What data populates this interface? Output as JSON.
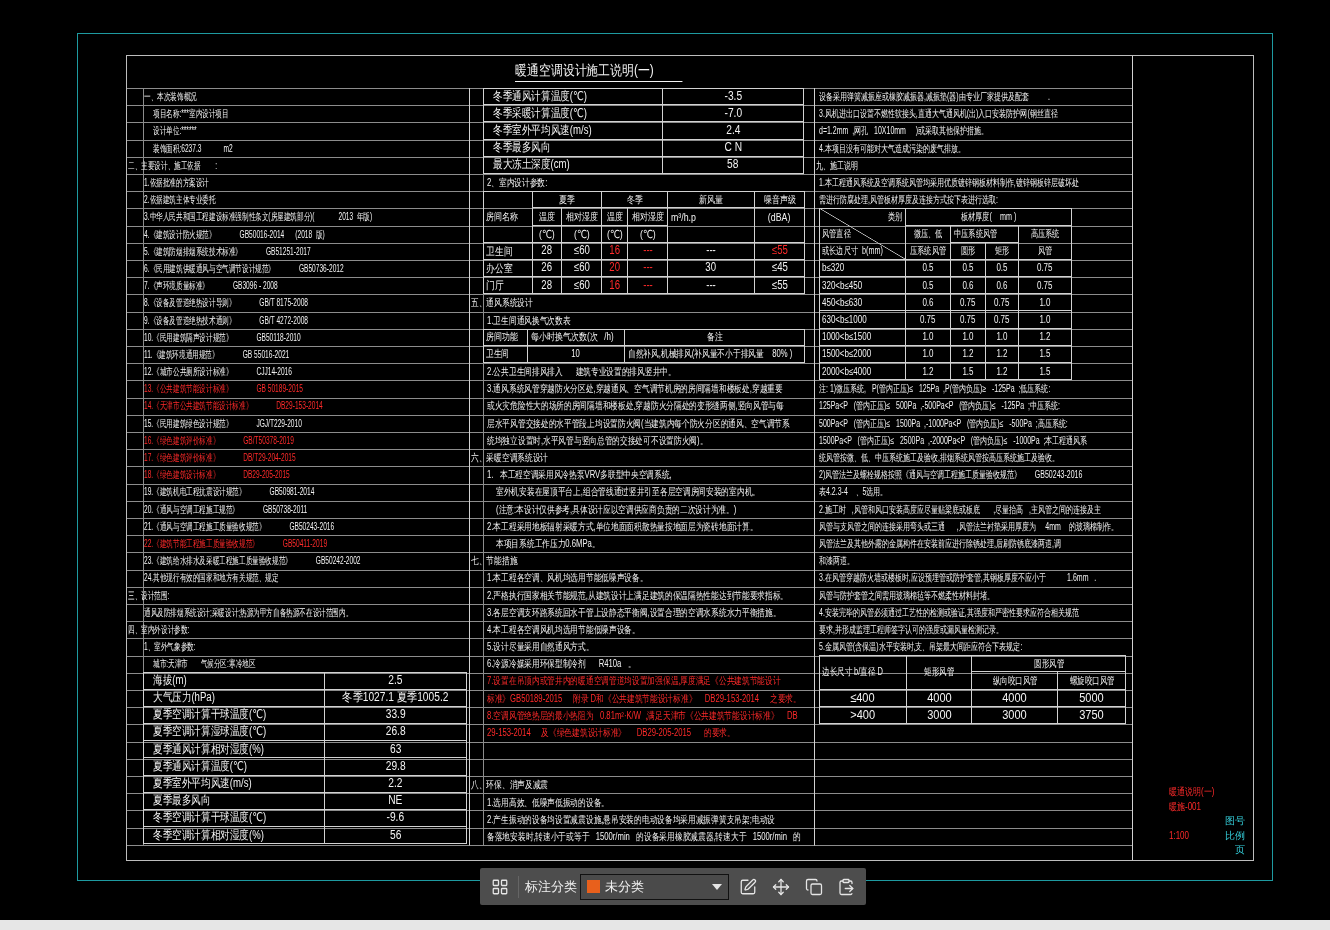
{
  "drawing": {
    "title": "暖通空调设计施工说明(一)",
    "columns": [
      {
        "blocks": [
          {
            "kind": "item",
            "text": "一、本次装饰概况",
            "highlighted": false
          },
          {
            "kind": "detail",
            "text": "项目名称:***室内设计项目",
            "highlighted": false
          },
          {
            "kind": "detail",
            "text": "设计单位:******",
            "highlighted": false
          },
          {
            "kind": "detail",
            "text": "装饰面积:6237.3            m2",
            "highlighted": false
          },
          {
            "kind": "section",
            "text": "二、主要设计、施工依据        :",
            "highlighted": false
          },
          {
            "kind": "item",
            "text": "1.依据批准的方案设计",
            "highlighted": false
          },
          {
            "kind": "item",
            "text": "2.依据建筑主体专业委托",
            "highlighted": false
          },
          {
            "kind": "item",
            "text": "3.中华人民共和国工程建设标准强制性条文(房屋建筑部分)(",
            "reference": "2013  年版)",
            "highlighted": false
          },
          {
            "kind": "item",
            "text": "4.《建筑设计防火规范》",
            "reference": "GB50016-2014      (2018  版)",
            "highlighted": false
          },
          {
            "kind": "item",
            "text": "5.《建筑防烟排烟系统技术标准》",
            "reference": "GB51251-2017",
            "highlighted": false
          },
          {
            "kind": "item",
            "text": "6.《民用建筑供暖通风与空气调节设计规范》",
            "reference": "GB50736-2012",
            "highlighted": false
          },
          {
            "kind": "item",
            "text": "7.《声环境质量标准》",
            "reference": "GB3096 - 2008",
            "highlighted": false
          },
          {
            "kind": "item",
            "text": "8.《设备及管道绝热设计导则》",
            "reference": "GB/T 8175-2008",
            "highlighted": false
          },
          {
            "kind": "item",
            "text": "9.《设备及管道绝热技术通则》",
            "reference": "GB/T 4272-2008",
            "highlighted": false
          },
          {
            "kind": "item",
            "text": "10.《民用建筑隔声设计规范》",
            "reference": "GB50118-2010",
            "highlighted": false
          },
          {
            "kind": "item",
            "text": "11.《建筑环境通用规范》",
            "reference": "GB 55016-2021",
            "highlighted": false
          },
          {
            "kind": "item",
            "text": "12.《城市公共厕所设计标准》",
            "reference": "CJJ14-2016",
            "highlighted": false
          },
          {
            "kind": "item",
            "text": "13.《公共建筑节能设计标准》",
            "reference": "GB 50189-2015",
            "highlighted": true
          },
          {
            "kind": "item",
            "text": "14.《天津市公共建筑节能设计标准》",
            "reference": "DB29-153-2014",
            "highlighted": true
          },
          {
            "kind": "item",
            "text": "15.《民用建筑绿色设计规范》",
            "reference": "JGJ/T229-2010",
            "highlighted": false
          },
          {
            "kind": "item",
            "text": "16.《绿色建筑评价标准》",
            "reference": "GB/T50378-2019",
            "highlighted": true
          },
          {
            "kind": "item",
            "text": "17.《绿色建筑评价标准》",
            "reference": "DB/T29-204-2015",
            "highlighted": true
          },
          {
            "kind": "item",
            "text": "18.《绿色建筑设计标准》",
            "reference": "DB29-205-2015",
            "highlighted": true
          },
          {
            "kind": "item",
            "text": "19.《建筑机电工程抗震设计规范》",
            "reference": "GB50981-2014",
            "highlighted": false
          },
          {
            "kind": "item",
            "text": "20.《通风与空调工程施工规范》",
            "reference": "GB50738-2011",
            "highlighted": false
          },
          {
            "kind": "item",
            "text": "21.《通风与空调工程施工质量验收规范》",
            "reference": "GB50243-2016",
            "highlighted": false
          },
          {
            "kind": "item",
            "text": "22.《建筑节能工程施工质量验收规范》",
            "reference": "GB50411-2019",
            "highlighted": true
          },
          {
            "kind": "item",
            "text": "23.《建筑给水排水及采暖工程施工质量验收规范》",
            "reference": "GB50242-2002",
            "highlighted": false
          },
          {
            "kind": "item",
            "text": "24.其他现行有效的国家和地方有关规范、规定",
            "highlighted": false
          },
          {
            "kind": "section",
            "text": "三、设计范围:",
            "highlighted": false
          },
          {
            "kind": "item",
            "text": "通风及防排烟系统设计;采暖设计;热源为甲方自备热源不在设计范围内。",
            "highlighted": false
          },
          {
            "kind": "section",
            "text": "四、室内外设计参数:",
            "highlighted": false
          },
          {
            "kind": "item",
            "text": "1、室外气象参数:",
            "highlighted": false
          },
          {
            "kind": "detail",
            "text": "城市:天津市       气候分区:寒冷地区",
            "highlighted": false
          },
          {
            "kind": "pair_table",
            "rows": [
              {
                "label": "海拔(m)",
                "value": "2.5"
              },
              {
                "label": "大气压力(hPa)",
                "value": "冬季1027.1 夏季1005.2"
              },
              {
                "label": "夏季空调计算干球温度(℃)",
                "value": "33.9"
              },
              {
                "label": "夏季空调计算湿球温度(℃)",
                "value": "26.8"
              },
              {
                "label": "夏季通风计算相对湿度(%)",
                "value": "63"
              },
              {
                "label": "夏季通风计算温度(℃)",
                "value": "29.8"
              },
              {
                "label": "夏季室外平均风速(m/s)",
                "value": "2.2"
              },
              {
                "label": "夏季最多风向",
                "value": "NE"
              },
              {
                "label": "冬季空调计算干球温度(℃)",
                "value": "-9.6"
              },
              {
                "label": "冬季空调计算相对湿度(%)",
                "value": "56"
              }
            ]
          }
        ]
      },
      {
        "blocks": [
          {
            "kind": "pair_table",
            "rows": [
              {
                "label": "冬季通风计算温度(℃)",
                "value": "-3.5"
              },
              {
                "label": "冬季采暖计算温度(℃)",
                "value": "-7.0"
              },
              {
                "label": "冬季室外平均风速(m/s)",
                "value": "2.4"
              },
              {
                "label": "冬季最多风向",
                "value": "C N"
              },
              {
                "label": "最大冻土深度(cm)",
                "value": "58"
              }
            ]
          },
          {
            "kind": "item",
            "text": "2、室内设计参数:",
            "highlighted": false
          },
          {
            "kind": "room_table",
            "headers": {
              "room": "房间名称",
              "summer": "夏季",
              "winter": "冬季",
              "fresh_air": "新风量",
              "noise": "噪音声级"
            },
            "subheaders": [
              "温度",
              "相对湿度",
              "温度",
              "相对湿度",
              "m³/h.p",
              "(dBA)"
            ],
            "units": [
              "(℃)",
              "(℃)",
              "(℃)",
              "(℃)"
            ],
            "rows": [
              {
                "cells": [
                  {
                    "text": "卫生间",
                    "highlighted": false
                  },
                  {
                    "text": "28",
                    "highlighted": false
                  },
                  {
                    "text": "≤60",
                    "highlighted": false
                  },
                  {
                    "text": "16",
                    "highlighted": true
                  },
                  {
                    "text": "---",
                    "highlighted": true
                  },
                  {
                    "text": "---",
                    "highlighted": false
                  },
                  {
                    "text": "≤55",
                    "highlighted": true
                  }
                ]
              },
              {
                "cells": [
                  {
                    "text": "办公室",
                    "highlighted": false
                  },
                  {
                    "text": "26",
                    "highlighted": false
                  },
                  {
                    "text": "≤60",
                    "highlighted": false
                  },
                  {
                    "text": "20",
                    "highlighted": true
                  },
                  {
                    "text": "---",
                    "highlighted": true
                  },
                  {
                    "text": "30",
                    "highlighted": false
                  },
                  {
                    "text": "≤45",
                    "highlighted": false
                  }
                ]
              },
              {
                "cells": [
                  {
                    "text": "门厅",
                    "highlighted": false
                  },
                  {
                    "text": "28",
                    "highlighted": false
                  },
                  {
                    "text": "≤60",
                    "highlighted": false
                  },
                  {
                    "text": "16",
                    "highlighted": true
                  },
                  {
                    "text": "---",
                    "highlighted": true
                  },
                  {
                    "text": "---",
                    "highlighted": false
                  },
                  {
                    "text": "≤55",
                    "highlighted": false
                  }
                ]
              }
            ]
          },
          {
            "kind": "section",
            "text": "五、通风系统设计",
            "highlighted": false
          },
          {
            "kind": "item",
            "text": "1.卫生间通风换气次数表",
            "highlighted": false
          },
          {
            "kind": "vent_table",
            "columns": [
              "房间功能",
              "每小时换气次数(次   /h)",
              "备注"
            ],
            "rows": [
              [
                "卫生间",
                "10",
                "自然补风,机械排风(补风量不小于排风量    80% )"
              ]
            ]
          },
          {
            "kind": "item",
            "text": "2.公共卫生间排风排入      建筑专业设置的排风竖井中。",
            "highlighted": false
          },
          {
            "kind": "item",
            "text": "3.通风系统风管穿越防火分区处,穿越通风、空气调节机房的房间隔墙和楼板处,穿越重要",
            "highlighted": false
          },
          {
            "kind": "item",
            "text": "或火灾危险性大的场所的房间隔墙和楼板处,穿越防火分隔处的变形缝两侧,竖向风管与每",
            "highlighted": false
          },
          {
            "kind": "item",
            "text": "层水平风管交接处的水平管段上均设置防火阀(当建筑内每个防火分区的通风、空气调节系",
            "highlighted": false
          },
          {
            "kind": "item",
            "text": "统均独立设置时,水平风管与竖向总管的交接处可不设置防火阀)。",
            "highlighted": false
          },
          {
            "kind": "section",
            "text": "六、采暖空调系统设计",
            "highlighted": false
          },
          {
            "kind": "item",
            "text": "1.   本工程空调采用风冷热泵VRV多联型中央空调系统,",
            "highlighted": false
          },
          {
            "kind": "detail",
            "text": "室外机安装在屋顶平台上,组合管线通过竖井引至各层空调房间安装的室内机。",
            "highlighted": false
          },
          {
            "kind": "detail",
            "text": "(注意:本设计仅供参考,具体设计应以空调供应商负责的二次设计为准。)",
            "highlighted": false
          },
          {
            "kind": "item",
            "text": "2.本工程采用地板辐射采暖方式,单位地面面积散热量按地面层为瓷砖地面计算。",
            "highlighted": false
          },
          {
            "kind": "detail",
            "text": "本项目系统工作压力0.6MPa。",
            "highlighted": false
          },
          {
            "kind": "section",
            "text": "七、节能措施",
            "highlighted": false
          },
          {
            "kind": "item",
            "text": "1.本工程各空调、风机均选用节能低噪声设备。",
            "highlighted": false
          },
          {
            "kind": "item",
            "text": "2.严格执行国家相关节能规范,从建筑设计上满足建筑的保温隔热性能达到节能要求指标。",
            "highlighted": false
          },
          {
            "kind": "item",
            "text": "3.各层空调支环路系统回水干管上设静态平衡阀,设置合理的空调水系统水力平衡措施。",
            "highlighted": false
          },
          {
            "kind": "item",
            "text": "4.本工程各空调风机均选用节能低噪声设备。",
            "highlighted": false
          },
          {
            "kind": "item",
            "text": "5.设计尽量采用自然通风方式。",
            "highlighted": false
          },
          {
            "kind": "item",
            "text": "6.冷源冷媒采用环保型制冷剂      R410a   。",
            "highlighted": false
          },
          {
            "kind": "item",
            "text": "7.设置在吊顶内或管井内的暖通空调管道均设置加强保温,厚度满足《公共建筑节能设计",
            "highlighted": true
          },
          {
            "kind": "item",
            "text": "标准》GB50189-2015     附录 D和《公共建筑节能设计标准》    DB29-153-2014     之要求。",
            "highlighted": true
          },
          {
            "kind": "item",
            "text": "8.空调风管绝热层的最小热阻为   0.81m²·K/W  ,满足天津市《公共建筑节能设计标准》    DB",
            "highlighted": true
          },
          {
            "kind": "item",
            "text": "29-153-2014     及《绿色建筑设计标准》     DB29-205-2015      的要求。",
            "highlighted": true
          }
        ],
        "bottom_blocks": [
          {
            "kind": "section",
            "text": "八、环保、消声及减震",
            "highlighted": false
          },
          {
            "kind": "item",
            "text": "1.选用高效、低噪声低振动的设备。",
            "highlighted": false
          },
          {
            "kind": "item",
            "text": "2.产生振动的设备均设置减震设施,悬吊安装的电动设备均采用减振弹簧支吊架;电动设",
            "highlighted": false
          },
          {
            "kind": "item",
            "text": "备落地安装时,转速小于或等于   1500r/min   的设备采用橡胶减震器,转速大于   1500r/min   的",
            "highlighted": false
          }
        ]
      },
      {
        "blocks": [
          {
            "kind": "line",
            "text": "设备采用弹簧减振座或橡胶减振器,减振垫(器)由专业厂家提供及配套          .",
            "highlighted": false
          },
          {
            "kind": "line",
            "text": "3.风机进出口设置不燃性软接头,直通大气通风机(出)入口安装防护网(钢丝直径",
            "highlighted": false
          },
          {
            "kind": "line",
            "text": "d=1.2mm  ,网孔   10X10mm     )或采取其他保护措施。",
            "highlighted": false
          },
          {
            "kind": "line",
            "text": "4.本项目没有可能对大气造成污染的废气排放。",
            "highlighted": false
          },
          {
            "kind": "section",
            "text": "九、施工说明",
            "highlighted": false
          },
          {
            "kind": "line",
            "text": "1.本工程通风系统及空调系统风管均采用优质镀锌钢板材料制作,镀锌钢板锌层破坏处",
            "highlighted": false
          },
          {
            "kind": "line",
            "text": "需进行防腐处理,风管板材厚度及连接方式按下表进行选取:",
            "highlighted": false
          },
          {
            "kind": "thickness_table",
            "corner": [
              "类别",
              "风管直径",
              "或长边尺寸  b(mm)"
            ],
            "title": "板材厚度(    mm )",
            "low": [
              "微压、低",
              "压系统风管"
            ],
            "medium": "中压系统风管",
            "medium_sub": [
              "圆形",
              "矩形"
            ],
            "high": [
              "高压系统",
              "风管"
            ],
            "rows": [
              [
                "b≤320",
                "0.5",
                "0.5",
                "0.5",
                "0.75"
              ],
              [
                "320<b≤450",
                "0.5",
                "0.6",
                "0.6",
                "0.75"
              ],
              [
                "450<b≤630",
                "0.6",
                "0.75",
                "0.75",
                "1.0"
              ],
              [
                "630<b≤1000",
                "0.75",
                "0.75",
                "0.75",
                "1.0"
              ],
              [
                "1000<b≤1500",
                "1.0",
                "1.0",
                "1.0",
                "1.2"
              ],
              [
                "1500<b≤2000",
                "1.0",
                "1.2",
                "1.2",
                "1.5"
              ],
              [
                "2000<b≤4000",
                "1.2",
                "1.5",
                "1.2",
                "1.5"
              ]
            ]
          },
          {
            "kind": "line",
            "text": "注: 1)微压系统,   P(管内正压)≤   125Pa  ,P(管内负压)≥   -125Pa  ;低压系统:",
            "highlighted": false
          },
          {
            "kind": "line",
            "text": "125Pa<P   (管内正压)≤   500Pa  ,-500Pa<P   (管内负压)≤   -125Pa  ;中压系统:",
            "highlighted": false
          },
          {
            "kind": "line",
            "text": "500Pa<P   (管内正压)≤   1500Pa  ,-1000Pa<P   (管内负压)≤   -500Pa  ;高压系统:",
            "highlighted": false
          },
          {
            "kind": "line",
            "text": "1500Pa<P   (管内正压)≤   2500Pa  ,-2000Pa<P   (管内负压)≤   -1000Pa  ;本工程通风系",
            "highlighted": false
          },
          {
            "kind": "line",
            "text": "统风管按微、低、中压系统施工及验收,排烟系统风管按高压系统施工及验收。",
            "highlighted": false
          },
          {
            "kind": "line",
            "text": "2)风管法兰及螺栓规格按照《通风与空调工程施工质量验收规范》       GB50243-2016",
            "highlighted": false
          },
          {
            "kind": "line",
            "text": "表4.2.3-4    、5选用。",
            "highlighted": false
          },
          {
            "kind": "line",
            "text": "2.施工时   ,风管和风口安装高度应尽量贴梁底或板底       ,尽量抬高   ,主风管之间的连接及主",
            "highlighted": false
          },
          {
            "kind": "line",
            "text": "风管与支风管之间的连接采用弯头或三通      ,风管法兰衬垫采用厚度为     4mm    的玻璃棉制作。",
            "highlighted": false
          },
          {
            "kind": "line",
            "text": "风管法兰及其他外露的金属构件在安装前应进行除锈处理,后刷防锈底漆两道,调",
            "highlighted": false
          },
          {
            "kind": "line",
            "text": "和漆两道。",
            "highlighted": false
          },
          {
            "kind": "line",
            "text": "3.在风管穿越防火墙或楼板时,应设预埋管或防护套管,其钢板厚度不应小于           1.6mm   .",
            "highlighted": false
          },
          {
            "kind": "line",
            "text": "风管与防护套管之间需用玻璃棉毡等不燃柔性材料封堵。",
            "highlighted": false
          },
          {
            "kind": "line",
            "text": "4.安装完毕的风管必须通过工艺性的检测或验证,其强度和严密性要求应符合相关规范",
            "highlighted": false
          },
          {
            "kind": "line",
            "text": "要求,并形成监理工程师签字认可的强度或漏风量检测记录。",
            "highlighted": false
          },
          {
            "kind": "line",
            "text": "5.金属风管(含保温)水平安装时,支、吊架最大间距应符合下表规定:",
            "highlighted": false
          },
          {
            "kind": "spacing_table",
            "size_header": "边长尺寸 b/直径 D",
            "rect_header": "矩形风管",
            "round_header": "圆形风管",
            "round_sub": [
              "纵向咬口风管",
              "螺旋咬口风管"
            ],
            "rows": [
              [
                "≤400",
                "4000",
                "4000",
                "5000"
              ],
              [
                ">400",
                "3000",
                "3000",
                "3750"
              ]
            ]
          }
        ]
      }
    ],
    "title_block": {
      "fields": [
        {
          "value": "暖通说明(一)"
        },
        {
          "value": "暖施-001"
        },
        {
          "label": "图号"
        },
        {
          "value": "1:100",
          "label": "比例"
        },
        {
          "label": "页"
        }
      ]
    }
  },
  "toolbar": {
    "label": "标注分类",
    "category": {
      "value": "未分类",
      "color": "#e8601c"
    }
  }
}
